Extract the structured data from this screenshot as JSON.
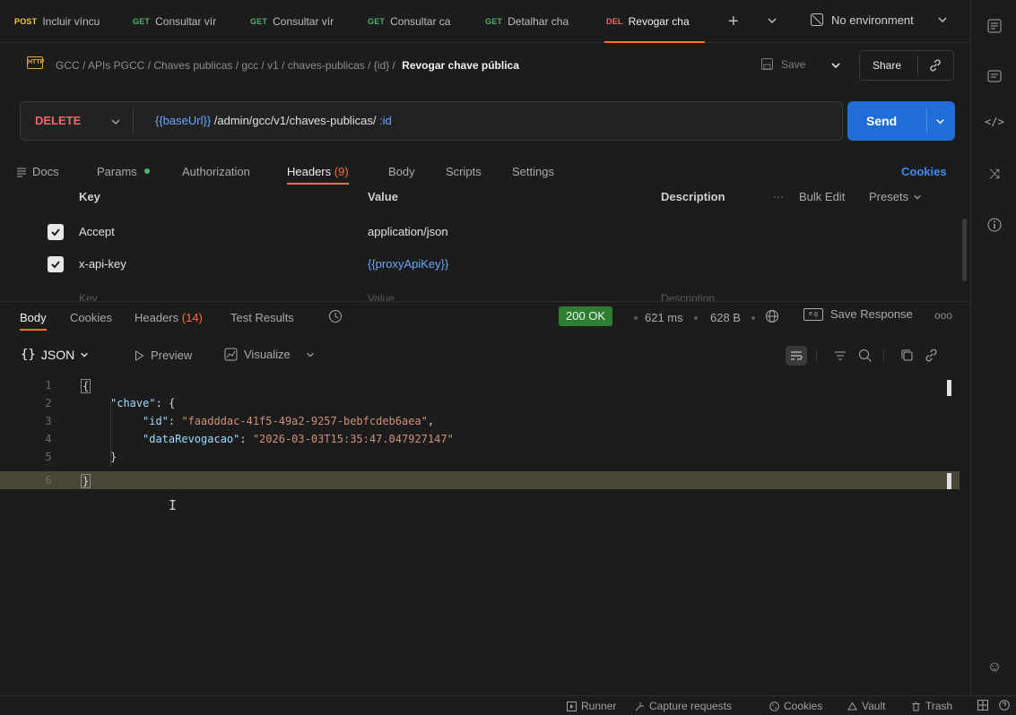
{
  "tabs": [
    {
      "method": "POST",
      "label": "Incluir víncu",
      "color": "#f5c541"
    },
    {
      "method": "GET",
      "label": "Consultar vír",
      "color": "#4fb06e"
    },
    {
      "method": "GET",
      "label": "Consultar vír",
      "color": "#4fb06e"
    },
    {
      "method": "GET",
      "label": "Consultar ca",
      "color": "#4fb06e"
    },
    {
      "method": "GET",
      "label": "Detalhar cha",
      "color": "#4fb06e"
    },
    {
      "method": "DEL",
      "label": "Revogar cha",
      "color": "#f06a6a"
    }
  ],
  "environment": "No environment",
  "breadcrumb": {
    "path": "GCC / APIs PGCC / Chaves publicas / gcc / v1 / chaves-publicas / {id} /",
    "current": "Revogar chave pública"
  },
  "toolbar": {
    "save_label": "Save",
    "share_label": "Share"
  },
  "request": {
    "method": "DELETE",
    "url_var": "{{baseUrl}}",
    "url_path": " /admin/gcc/v1/chaves-publicas/",
    "url_param": " :id",
    "send_label": "Send"
  },
  "request_tabs": {
    "docs": "Docs",
    "params": "Params",
    "authorization": "Authorization",
    "headers": "Headers",
    "headers_count": "(9)",
    "body": "Body",
    "scripts": "Scripts",
    "settings": "Settings",
    "cookies": "Cookies"
  },
  "headers_table": {
    "col_key": "Key",
    "col_value": "Value",
    "col_description": "Description",
    "bulk_edit": "Bulk Edit",
    "presets": "Presets",
    "rows": [
      {
        "key": "Accept",
        "value": "application/json"
      },
      {
        "key": "x-api-key",
        "value": "{{proxyApiKey}}"
      }
    ],
    "placeholder_key": "Key",
    "placeholder_value": "Value",
    "placeholder_description": "Description"
  },
  "response": {
    "tabs": {
      "body": "Body",
      "cookies": "Cookies",
      "headers": "Headers",
      "headers_count": "(14)",
      "test_results": "Test Results"
    },
    "status": "200 OK",
    "time": "621 ms",
    "size": "628 B",
    "save_response": "Save Response",
    "format": "JSON",
    "preview": "Preview",
    "visualize": "Visualize"
  },
  "code_lines": {
    "numbers": [
      "1",
      "2",
      "3",
      "4",
      "5",
      "6"
    ],
    "l1": "{",
    "l2_key": "\"chave\"",
    "l2_rest": ": {",
    "l3_key": "\"id\"",
    "l3_colon": ": ",
    "l3_val": "\"faadddac-41f5-49a2-9257-bebfcdeb6aea\"",
    "l3_comma": ",",
    "l4_key": "\"dataRevogacao\"",
    "l4_colon": ": ",
    "l4_val": "\"2026-03-03T15:35:47.047927147\"",
    "l5": "}",
    "l6": "}"
  },
  "statusbar": {
    "runner": "Runner",
    "capture": "Capture requests",
    "cookies": "Cookies",
    "vault": "Vault",
    "trash": "Trash"
  },
  "colors": {
    "accent": "#ff6c37",
    "send": "#1f6ed8",
    "status_ok": "#2e7d32",
    "var": "#6aa6ff"
  }
}
